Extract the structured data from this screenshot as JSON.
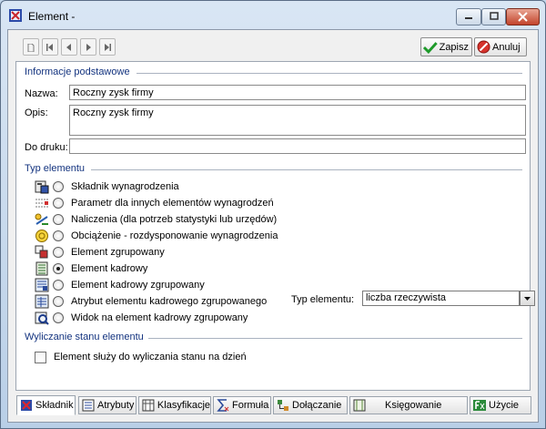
{
  "window": {
    "title": "Element -",
    "colors": {
      "accent": "#13337f",
      "titlebar": "#c3d6ea",
      "close": "#c2442b"
    }
  },
  "toolbar": {
    "save_label": "Zapisz",
    "cancel_label": "Anuluj"
  },
  "basic": {
    "section_title": "Informacje podstawowe",
    "name_label": "Nazwa:",
    "name_value": "Roczny zysk firmy",
    "desc_label": "Opis:",
    "desc_value": "Roczny zysk firmy",
    "print_label": "Do druku:",
    "print_value": ""
  },
  "type_section": {
    "title": "Typ elementu",
    "options": [
      {
        "label": "Składnik wynagrodzenia",
        "icon": "salary-component-icon",
        "selected": false
      },
      {
        "label": "Parametr dla innych elementów wynagrodzeń",
        "icon": "parameter-icon",
        "selected": false
      },
      {
        "label": "Naliczenia (dla potrzeb statystyki lub urzędów)",
        "icon": "calculation-icon",
        "selected": false
      },
      {
        "label": "Obciążenie - rozdysponowanie wynagrodzenia",
        "icon": "charge-icon",
        "selected": false
      },
      {
        "label": "Element zgrupowany",
        "icon": "grouped-element-icon",
        "selected": false
      },
      {
        "label": "Element kadrowy",
        "icon": "hr-element-icon",
        "selected": true
      },
      {
        "label": "Element kadrowy zgrupowany",
        "icon": "hr-grouped-icon",
        "selected": false
      },
      {
        "label": "Atrybut elementu kadrowego zgrupowanego",
        "icon": "attribute-icon",
        "selected": false
      },
      {
        "label": "Widok na element kadrowy zgrupowany",
        "icon": "view-icon",
        "selected": false
      }
    ],
    "type_label": "Typ elementu:",
    "type_value": "liczba rzeczywista"
  },
  "calc_section": {
    "title": "Wyliczanie stanu elementu",
    "checkbox_label": "Element służy do wyliczania stanu na dzień",
    "checked": false
  },
  "tabs": [
    {
      "label": "Składnik",
      "icon": "component-tab-icon",
      "active": true
    },
    {
      "label": "Atrybuty",
      "icon": "attributes-tab-icon",
      "active": false
    },
    {
      "label": "Klasyfikacje",
      "icon": "classifications-tab-icon",
      "active": false
    },
    {
      "label": "Formuła",
      "icon": "formula-tab-icon",
      "active": false
    },
    {
      "label": "Dołączanie",
      "icon": "attach-tab-icon",
      "active": false
    },
    {
      "label": "Księgowanie",
      "icon": "accounting-tab-icon",
      "active": false
    },
    {
      "label": "Użycie",
      "icon": "usage-tab-icon",
      "active": false
    }
  ]
}
